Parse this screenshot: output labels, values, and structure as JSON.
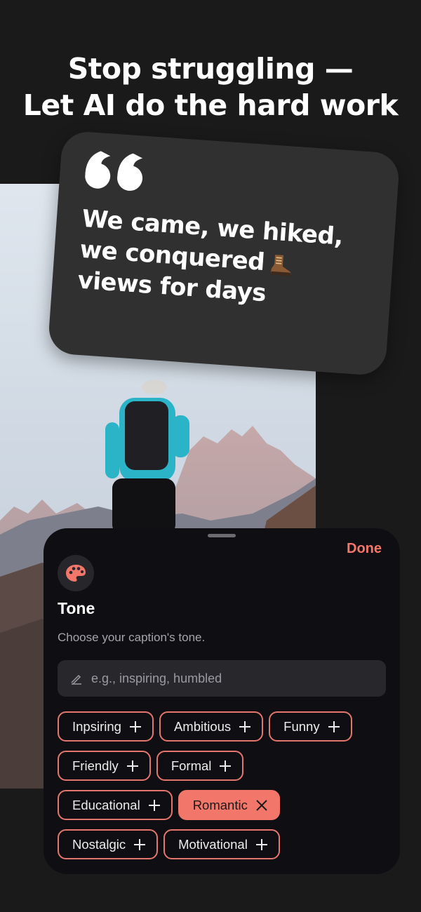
{
  "headline": {
    "line1": "Stop struggling —",
    "line2": "Let AI do the hard work"
  },
  "quote": {
    "line1": "We came, we hiked,",
    "line2": "we conquered",
    "line2_emoji_icon": "hiking-boot-icon",
    "line3": "views for days"
  },
  "sheet": {
    "done_label": "Done",
    "icon": "palette-icon",
    "title": "Tone",
    "subtitle": "Choose your caption's tone.",
    "input": {
      "placeholder": "e.g., inspiring, humbled",
      "value": "",
      "icon": "pencil-icon"
    },
    "chip_rows": [
      [
        {
          "label": "Inpsiring",
          "selected": false
        },
        {
          "label": "Ambitious",
          "selected": false
        },
        {
          "label": "Funny",
          "selected": false
        }
      ],
      [
        {
          "label": "Friendly",
          "selected": false
        },
        {
          "label": "Formal",
          "selected": false
        }
      ],
      [
        {
          "label": "Educational",
          "selected": false
        },
        {
          "label": "Romantic",
          "selected": true
        }
      ],
      [
        {
          "label": "Nostalgic",
          "selected": false
        },
        {
          "label": "Motivational",
          "selected": false
        }
      ]
    ]
  },
  "colors": {
    "background": "#1a1a1a",
    "accent": "#f2766a",
    "sheet": "#0f0f13",
    "card": "#303030"
  }
}
